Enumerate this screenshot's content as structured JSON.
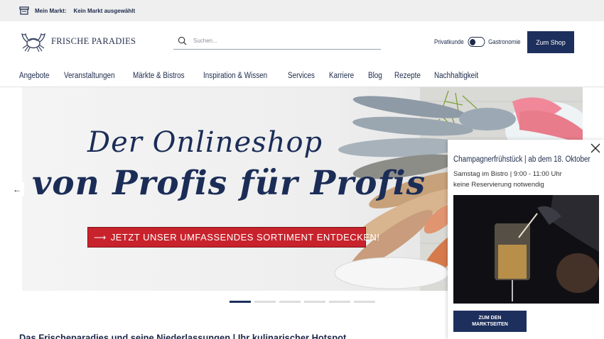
{
  "topbar": {
    "label": "Mein Markt:",
    "value": "Kein Markt ausgewählt",
    "icon": "store-icon"
  },
  "header": {
    "logo_text": "FRISCHE PARADIES",
    "search_placeholder": "Suchen...",
    "toggle_left": "Privatkunde",
    "toggle_right": "Gastronomie",
    "shop_button": "Zum Shop"
  },
  "nav": {
    "items": [
      "Angebote",
      "Veranstaltungen",
      "Märkte & Bistros",
      "Inspiration & Wissen",
      "Services",
      "Karriere",
      "Blog",
      "Rezepte",
      "Nachhaltigkeit"
    ]
  },
  "hero": {
    "line1": "Der Onlineshop",
    "line2": "von Profis für Profis",
    "cta": "JETZT UNSER UMFASSENDES SORTIMENT ENTDECKEN!",
    "slides_total": 6,
    "active_slide": 1
  },
  "popup": {
    "title": "Champagnerfrühstück | ab dem 18. Oktober",
    "line1": "Samstag im Bistro | 9:00 - 11:00 Uhr",
    "line2": "keine Reservierung notwendig",
    "button_line1": "ZUM DEN",
    "button_line2": "MARKTSEITEN"
  },
  "main": {
    "heading": "Das Frischeparadies und seine Niederlassungen | Ihr kulinarischer Hotspot"
  },
  "colors": {
    "navy": "#1d2f5c",
    "red": "#c8232c",
    "topbar_bg": "#efefef"
  }
}
